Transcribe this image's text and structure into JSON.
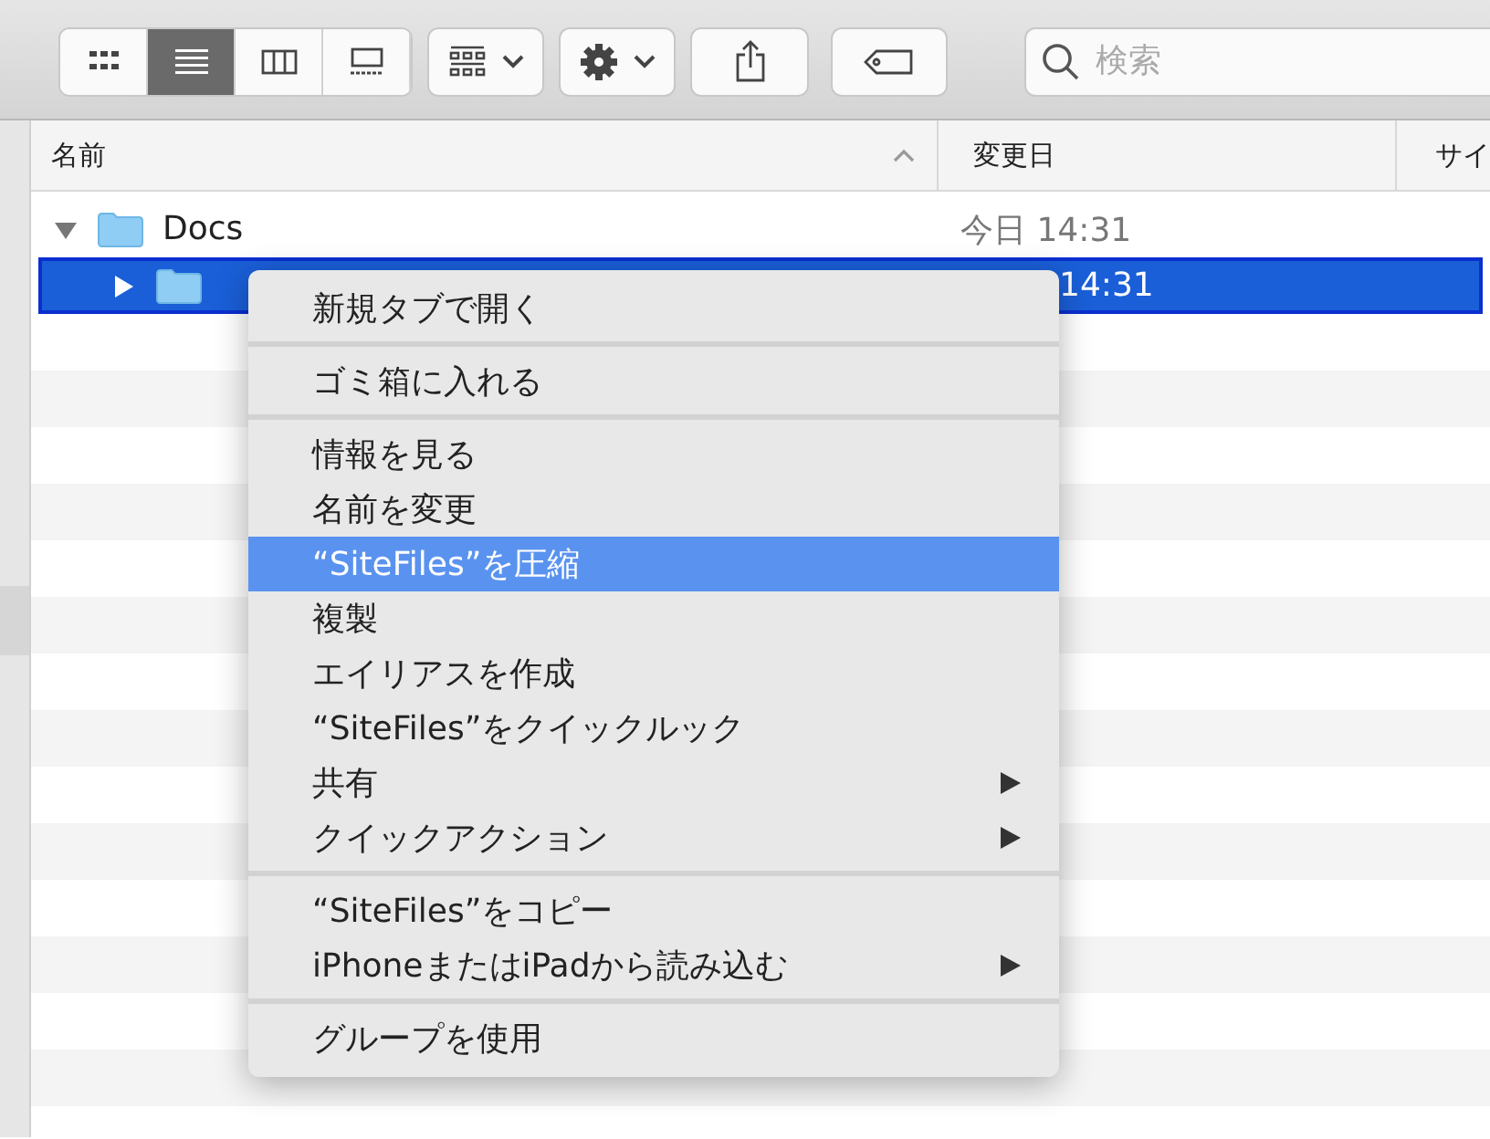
{
  "toolbar": {
    "view_modes": [
      {
        "selected": false
      },
      {
        "selected": true
      },
      {
        "selected": false
      },
      {
        "selected": false
      }
    ],
    "search": {
      "placeholder": "検索"
    }
  },
  "columns": [
    "名前",
    "変更日",
    "サイ"
  ],
  "rows": [
    {
      "name": "Docs",
      "date": "今日 14:31",
      "expanded": true,
      "selected": false
    },
    {
      "date": "14:31",
      "expanded": false,
      "selected": true
    }
  ],
  "context_menu": [
    {
      "kind": "item",
      "label": "新規タブで開く",
      "highlighted": false,
      "submenu": false
    },
    {
      "kind": "separator"
    },
    {
      "kind": "item",
      "label": "ゴミ箱に入れる",
      "highlighted": false,
      "submenu": false
    },
    {
      "kind": "separator"
    },
    {
      "kind": "item",
      "label": "情報を見る",
      "highlighted": false,
      "submenu": false
    },
    {
      "kind": "item",
      "label": "名前を変更",
      "highlighted": false,
      "submenu": false
    },
    {
      "kind": "item",
      "label": "“SiteFiles”を圧縮",
      "highlighted": true,
      "submenu": false
    },
    {
      "kind": "item",
      "label": "複製",
      "highlighted": false,
      "submenu": false
    },
    {
      "kind": "item",
      "label": "エイリアスを作成",
      "highlighted": false,
      "submenu": false
    },
    {
      "kind": "item",
      "label": "“SiteFiles”をクイックルック",
      "highlighted": false,
      "submenu": false
    },
    {
      "kind": "item",
      "label": "共有",
      "highlighted": false,
      "submenu": true
    },
    {
      "kind": "item",
      "label": "クイックアクション",
      "highlighted": false,
      "submenu": true
    },
    {
      "kind": "separator"
    },
    {
      "kind": "item",
      "label": "“SiteFiles”をコピー",
      "highlighted": false,
      "submenu": false
    },
    {
      "kind": "item",
      "label": "iPhoneまたはiPadから読み込む",
      "highlighted": false,
      "submenu": true
    },
    {
      "kind": "separator"
    },
    {
      "kind": "item",
      "label": "グループを使用",
      "highlighted": false,
      "submenu": false
    }
  ]
}
